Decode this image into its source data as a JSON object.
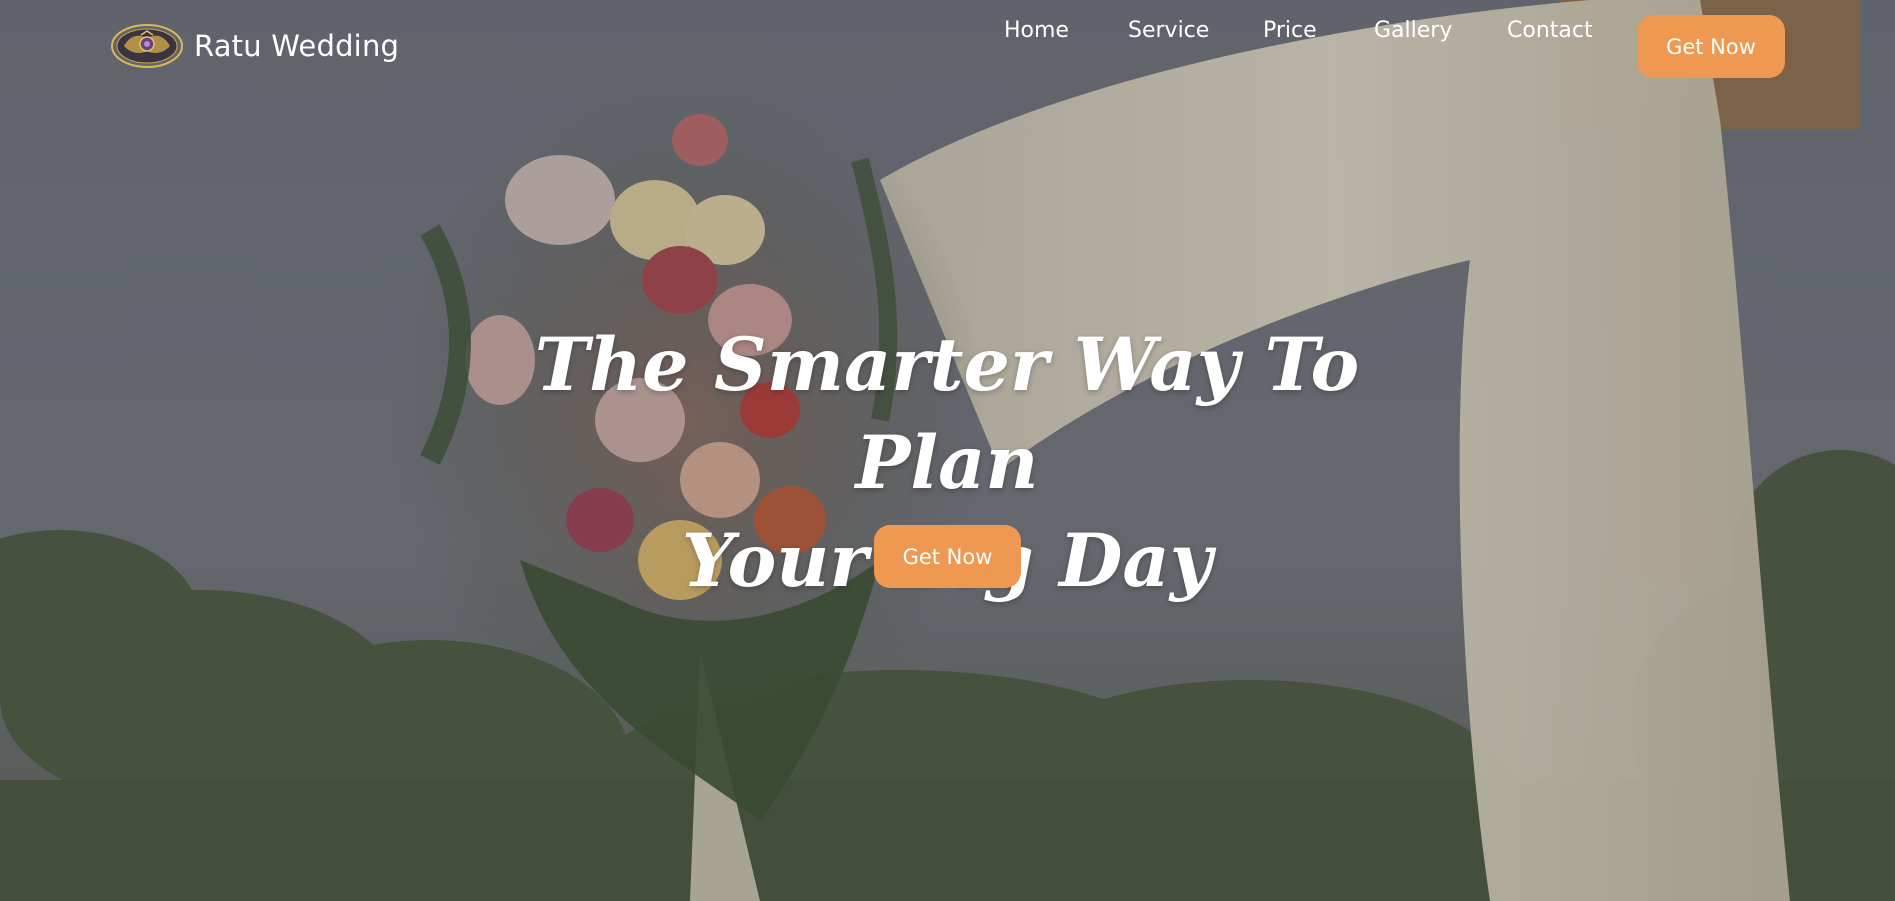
{
  "brand": {
    "name": "Ratu Wedding",
    "logo_icon": "crest-emblem-icon"
  },
  "nav": {
    "items": [
      {
        "label": "Home"
      },
      {
        "label": "Service"
      },
      {
        "label": "Price"
      },
      {
        "label": "Gallery"
      },
      {
        "label": "Contact"
      }
    ],
    "cta_label": "Get Now"
  },
  "hero": {
    "title_line1": "The Smarter Way To Plan",
    "title_line2": "Your Big Day",
    "cta_label": "Get Now"
  },
  "colors": {
    "accent": "#ee9851",
    "text": "#ffffff"
  }
}
